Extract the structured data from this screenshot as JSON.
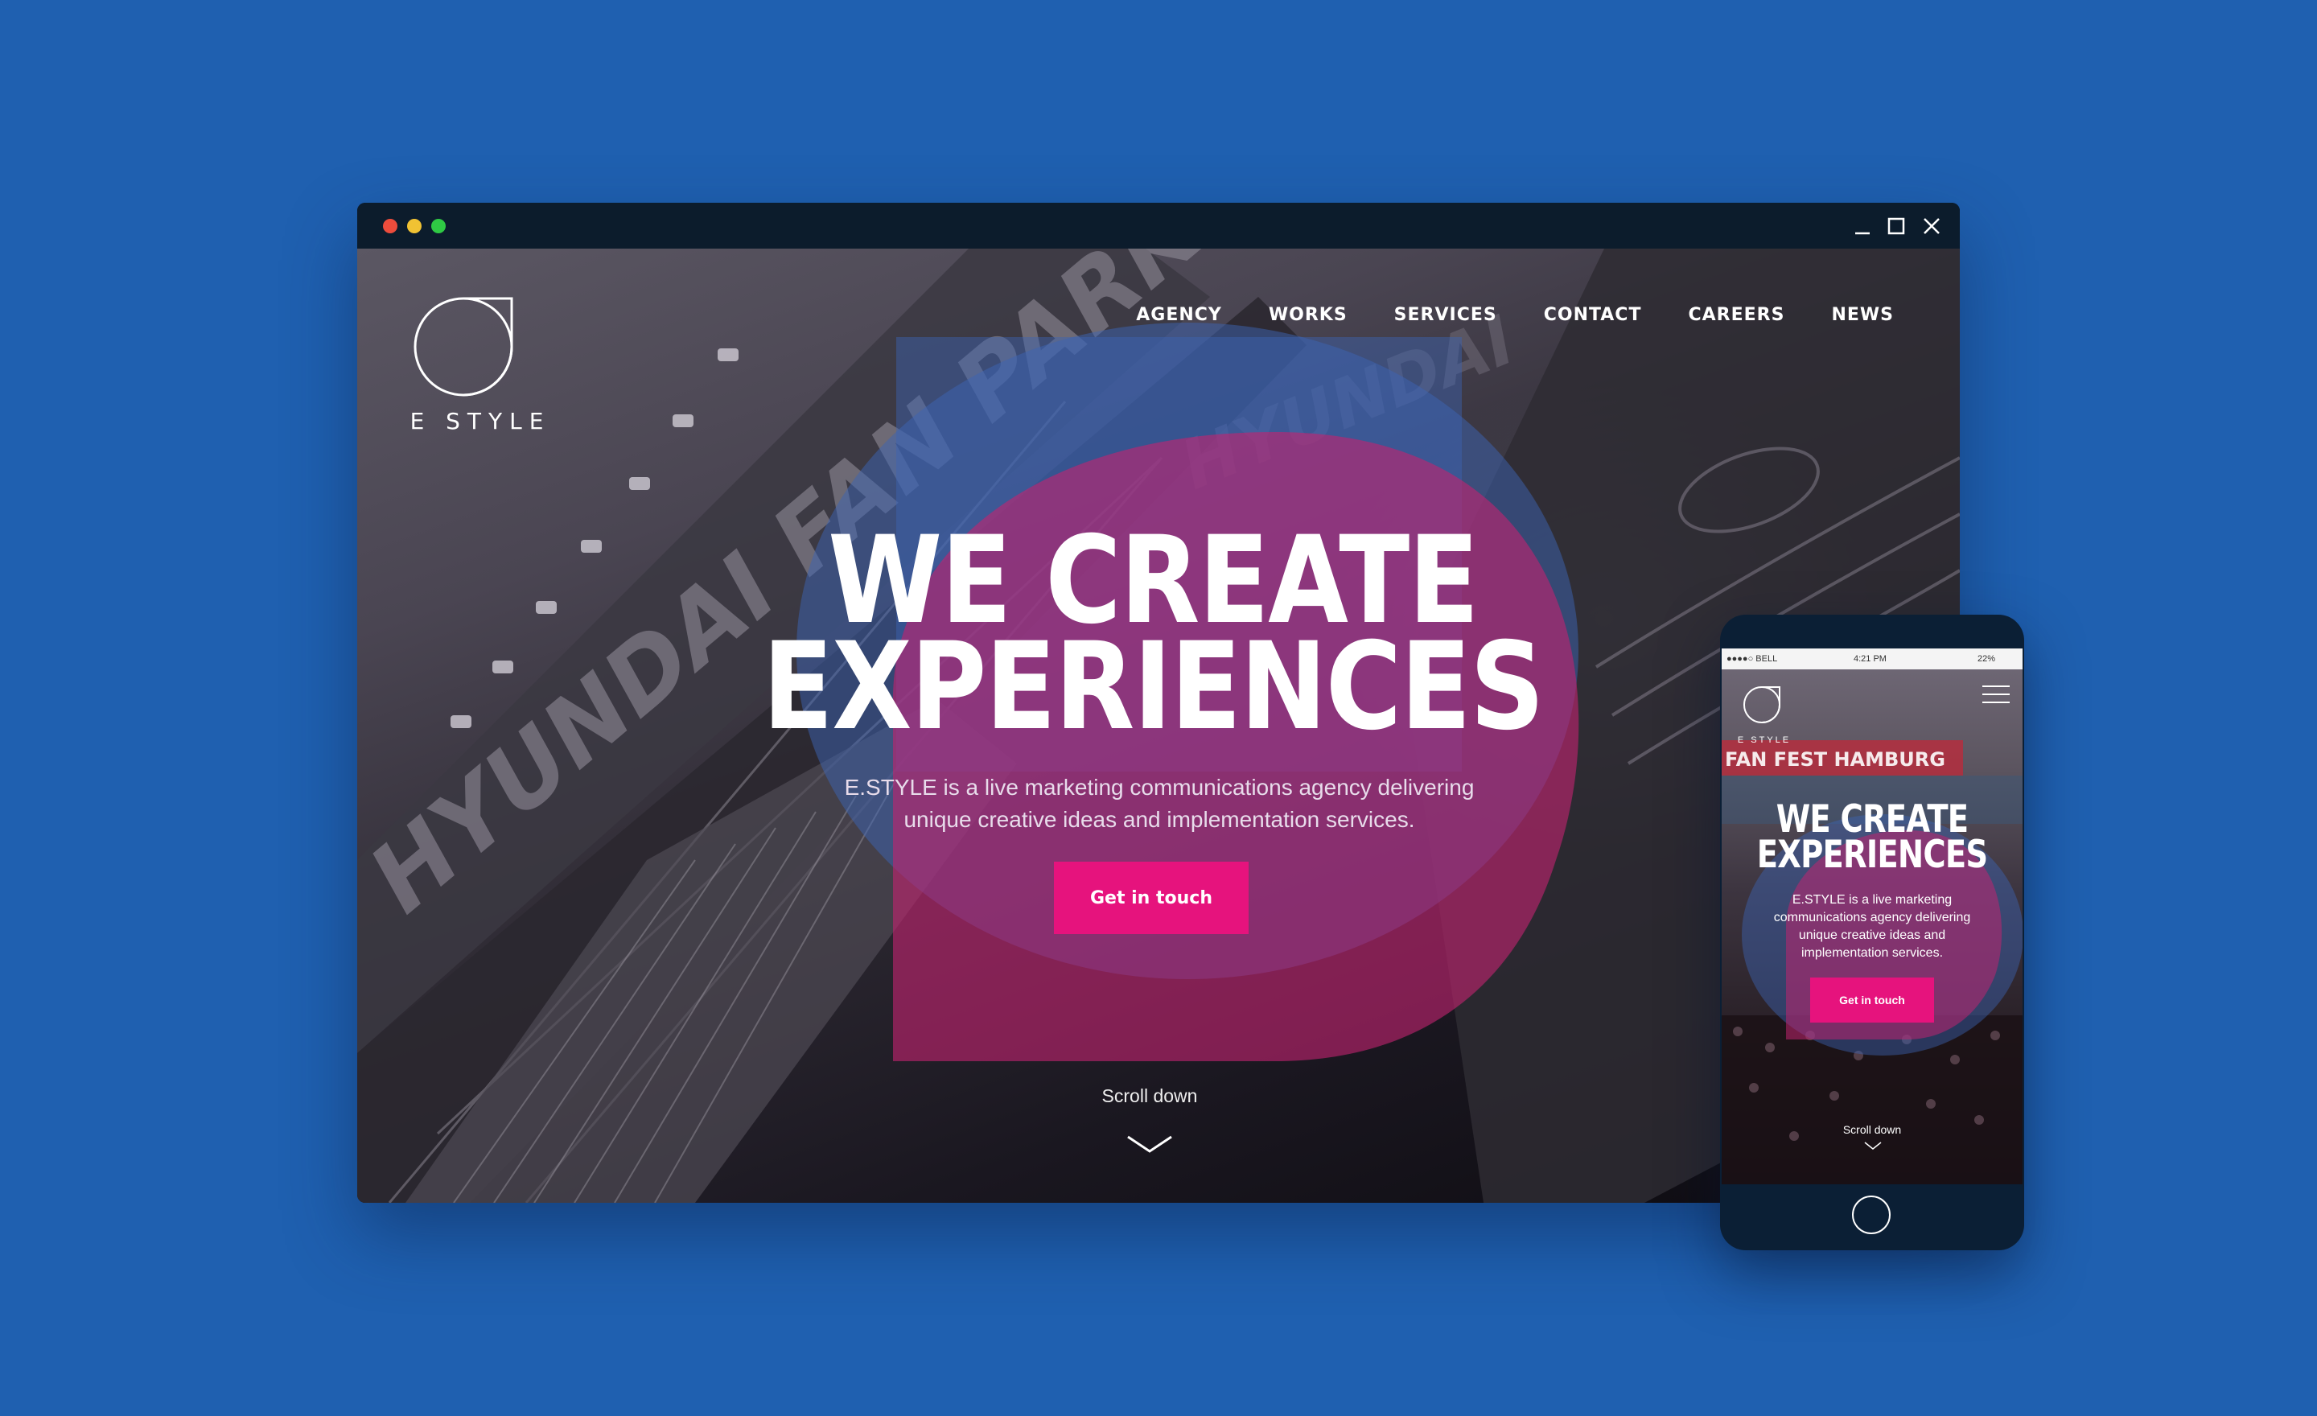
{
  "colors": {
    "background": "#1f60b0",
    "accent": "#e6137d",
    "titlebar": "#0c1c2c",
    "blob_blue": "#3b64b4",
    "blob_pink": "#c0246f"
  },
  "desktop": {
    "window_controls": [
      "minimize-icon",
      "maximize-icon",
      "close-icon"
    ],
    "logo_text": "E STYLE",
    "nav": [
      "AGENCY",
      "WORKS",
      "SERVICES",
      "CONTACT",
      "CAREERS",
      "NEWS"
    ],
    "background_signage": [
      "HYUNDAI FAN PARK",
      "HYUNDAI"
    ],
    "headline_line1": "WE CREATE",
    "headline_line2": "EXPERIENCES",
    "subtitle": "E.STYLE is a live marketing communications agency delivering unique creative ideas and implementation services.",
    "cta_label": "Get in touch",
    "scroll_label": "Scroll down"
  },
  "phone": {
    "status_carrier": "●●●●○ BELL",
    "status_time": "4:21 PM",
    "status_battery": "22%",
    "logo_text": "E STYLE",
    "banner_text": "FAN FEST HAMBURG",
    "headline_line1": "WE CREATE",
    "headline_line2": "EXPERIENCES",
    "subtitle": "E.STYLE is a live marketing communications agency delivering unique creative ideas and implementation services.",
    "cta_label": "Get in touch",
    "scroll_label": "Scroll down"
  }
}
